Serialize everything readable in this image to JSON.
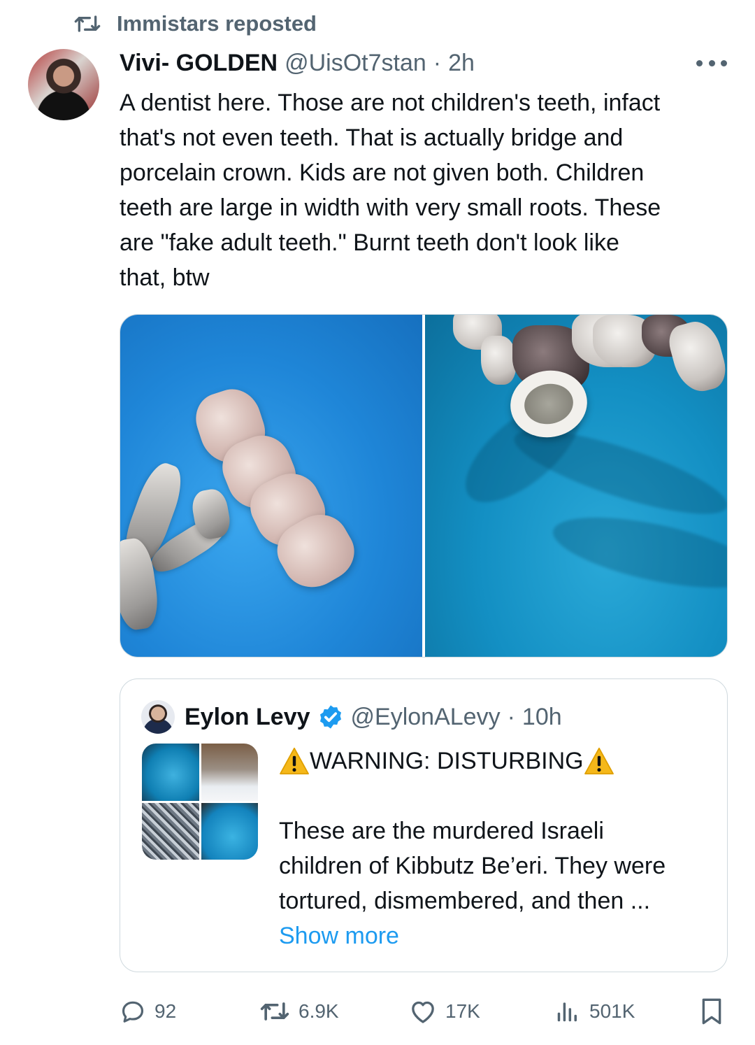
{
  "repost": {
    "label": "Immistars reposted",
    "icon": "repost-icon"
  },
  "tweet": {
    "author_name": "Vivi- GOLDEN",
    "author_handle": "@UisOt7stan",
    "separator": "·",
    "time": "2h",
    "text_lines": [
      "A dentist here. Those are not children's teeth, infact",
      "that's not even teeth. That is actually bridge and",
      "porcelain crown. Kids are not given both. Children",
      "teeth are large in width with very small roots. These",
      "are \"fake adult teeth.\" Burnt teeth don't look like",
      "that, btw"
    ]
  },
  "quoted": {
    "author_name": "Eylon Levy",
    "author_handle": "@EylonALevy",
    "separator": "·",
    "time": "10h",
    "warning": "WARNING: DISTURBING",
    "text_lines": [
      "These are the murdered Israeli",
      "children of Kibbutz Be’eri. They were",
      "tortured, dismembered, and then ..."
    ],
    "show_more": "Show more"
  },
  "actions": {
    "replies": "92",
    "reposts": "6.9K",
    "likes": "17K",
    "views": "501K"
  },
  "colors": {
    "text": "#0f1419",
    "secondary": "#536471",
    "accent": "#1d9bf0",
    "border": "#cfd9de"
  }
}
